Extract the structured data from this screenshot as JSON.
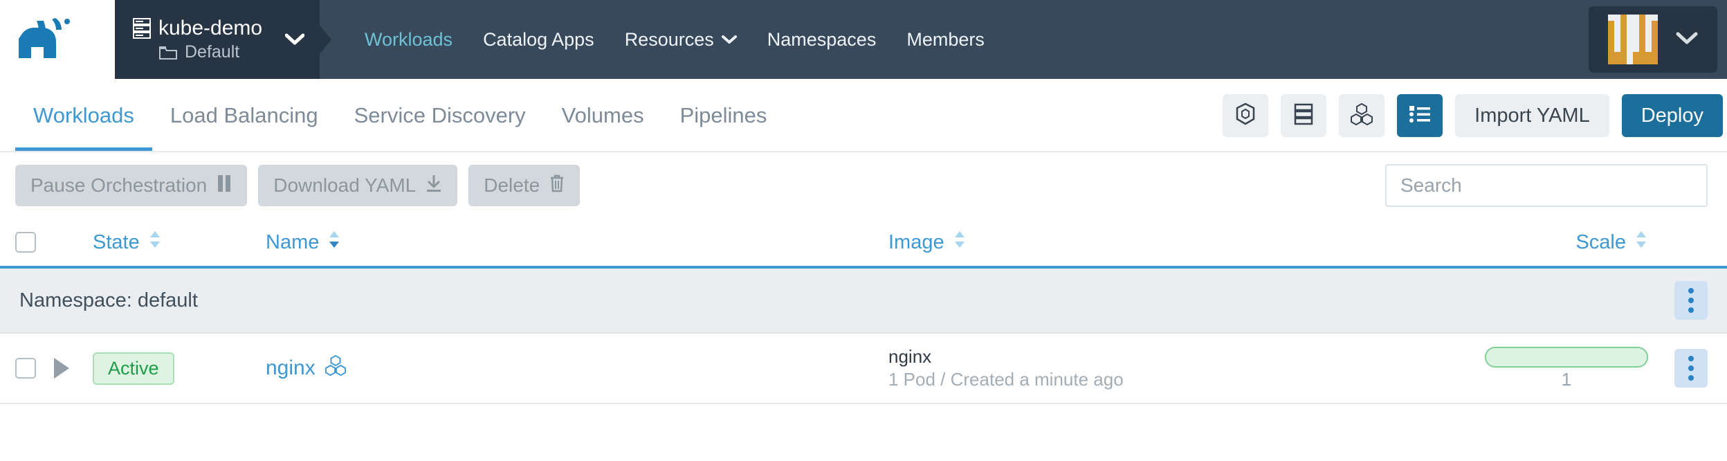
{
  "topnav": {
    "logo": "rancher-logo",
    "cluster": {
      "icon": "server-icon",
      "name": "kube-demo"
    },
    "project": {
      "icon": "folder-icon",
      "name": "Default"
    },
    "items": [
      {
        "label": "Workloads",
        "active": true,
        "caret": false
      },
      {
        "label": "Catalog Apps",
        "active": false,
        "caret": false
      },
      {
        "label": "Resources",
        "active": false,
        "caret": true
      },
      {
        "label": "Namespaces",
        "active": false,
        "caret": false
      },
      {
        "label": "Members",
        "active": false,
        "caret": false
      }
    ],
    "user": {
      "avatar": "user-identicon-avatar",
      "caret": "chevron-down-icon"
    },
    "colors": {
      "bar": "#38495c",
      "picker": "#273443",
      "active_link": "#6fc1d4"
    }
  },
  "tabbar": {
    "tabs": [
      {
        "label": "Workloads",
        "active": true
      },
      {
        "label": "Load Balancing",
        "active": false
      },
      {
        "label": "Service Discovery",
        "active": false
      },
      {
        "label": "Volumes",
        "active": false
      },
      {
        "label": "Pipelines",
        "active": false
      }
    ],
    "view_buttons": [
      {
        "icon": "pod-cube-icon",
        "active": false
      },
      {
        "icon": "node-stack-icon",
        "active": false
      },
      {
        "icon": "cluster-cubes-icon",
        "active": false
      },
      {
        "icon": "list-view-icon",
        "active": true
      }
    ],
    "import_yaml_label": "Import YAML",
    "deploy_label": "Deploy",
    "accent": "#1d6f9b"
  },
  "toolbar": {
    "buttons": [
      {
        "label": "Pause Orchestration",
        "icon": "pause-icon",
        "disabled": true
      },
      {
        "label": "Download YAML",
        "icon": "download-icon",
        "disabled": true
      },
      {
        "label": "Delete",
        "icon": "trash-icon",
        "disabled": true
      }
    ],
    "search": {
      "value": "",
      "placeholder": "Search"
    }
  },
  "table": {
    "headers": [
      {
        "label": "State",
        "sorted": false
      },
      {
        "label": "Name",
        "sorted": true
      },
      {
        "label": "Image",
        "sorted": false
      },
      {
        "label": "Scale",
        "sorted": false
      }
    ],
    "group": {
      "label": "Namespace: default",
      "menu": "kebab-menu-icon"
    },
    "rows": [
      {
        "checked": false,
        "state": "Active",
        "name": "nginx",
        "name_icon": "workload-cubes-icon",
        "image": "nginx",
        "image_sub": "1 Pod / Created a minute ago",
        "scale_value": "1",
        "scale_percent": 100,
        "menu": "kebab-menu-icon"
      }
    ]
  }
}
